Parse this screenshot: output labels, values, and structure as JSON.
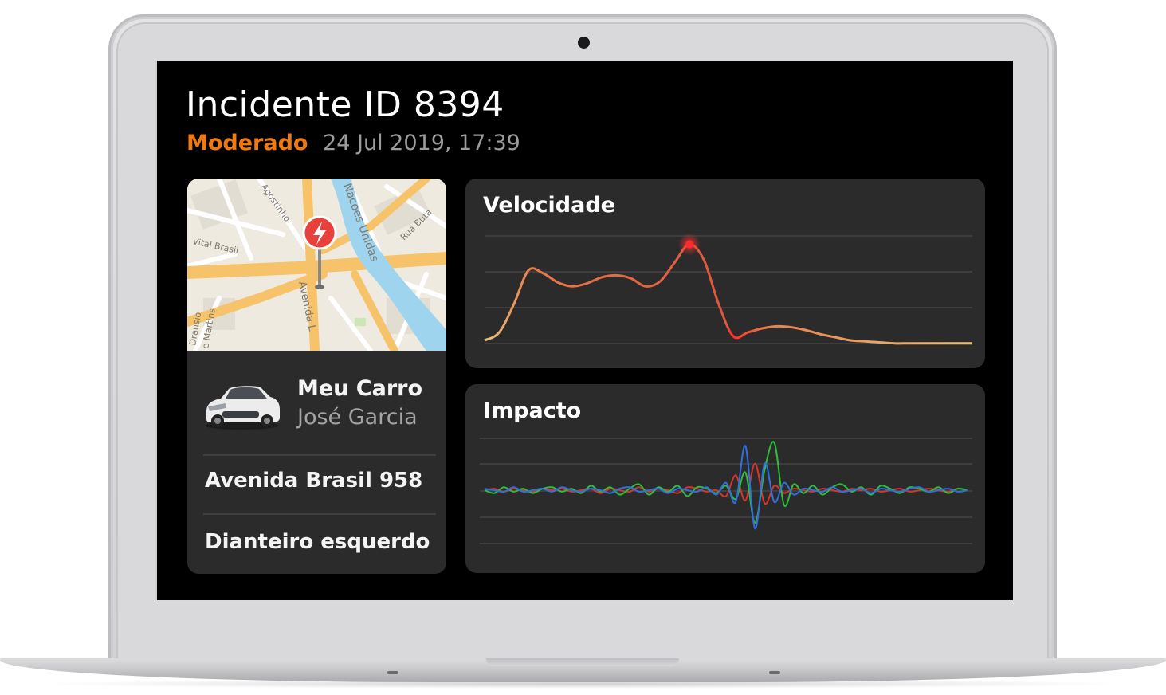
{
  "incident": {
    "title": "Incidente ID 8394",
    "severity": "Moderado",
    "datetime": "24 Jul 2019, 17:39"
  },
  "map": {
    "street_labels": [
      "Vital Brasil",
      "Agostinho",
      "Nacoes Unidas",
      "Rua Buta",
      "Avenida L",
      "Drausio",
      "e Martins"
    ],
    "pin_icon": "lightning-icon"
  },
  "vehicle": {
    "name": "Meu Carro",
    "owner": "José Garcia",
    "image_icon": "car-icon"
  },
  "details": {
    "address": "Avenida Brasil 958",
    "impact_position": "Dianteiro esquerdo"
  },
  "colors": {
    "severity": "#f07a12",
    "card_bg": "#2b2b2b",
    "screen_bg": "#000000",
    "speed_line_start": "#e8c47a",
    "speed_line_peak": "#ff2a2a",
    "impact_red": "#d9342b",
    "impact_green": "#2ebd3b",
    "impact_blue": "#2f6fe0"
  },
  "chart_data": [
    {
      "type": "line",
      "title": "Velocidade",
      "x": [
        0,
        3,
        6,
        9,
        12,
        15,
        18,
        21,
        24,
        27,
        30,
        33,
        36,
        39,
        42,
        45,
        48,
        51,
        54,
        57,
        60,
        63,
        66,
        69,
        72,
        75,
        78,
        81,
        84,
        87,
        90,
        93,
        96,
        100
      ],
      "series": [
        {
          "values": [
            4,
            12,
            40,
            74,
            71,
            62,
            58,
            61,
            67,
            69,
            66,
            58,
            63,
            82,
            100,
            84,
            40,
            8,
            12,
            16,
            18,
            17,
            14,
            10,
            7,
            4,
            3,
            2,
            1,
            1,
            1,
            1,
            1,
            1
          ]
        }
      ],
      "peak_index": 14,
      "ylim": [
        0,
        110
      ],
      "grid": true
    },
    {
      "type": "line",
      "title": "Impacto",
      "x": [
        0,
        2,
        4,
        6,
        8,
        10,
        12,
        14,
        16,
        18,
        20,
        22,
        24,
        26,
        28,
        30,
        32,
        34,
        36,
        38,
        40,
        42,
        44,
        46,
        48,
        50,
        52,
        54,
        56,
        58,
        60,
        62,
        64,
        66,
        68,
        70,
        72,
        74,
        76,
        78,
        80,
        82,
        84,
        86,
        88,
        90,
        92,
        94,
        96,
        98,
        100
      ],
      "series": [
        {
          "name": "red",
          "values": [
            0,
            1,
            -1,
            1,
            0,
            -1,
            1,
            0,
            1,
            -1,
            0,
            1,
            -2,
            1,
            0,
            -1,
            2,
            -1,
            1,
            0,
            -2,
            2,
            1,
            -1,
            0,
            -4,
            10,
            -7,
            18,
            -9,
            3,
            -2,
            1,
            0,
            -1,
            1,
            0,
            -1,
            1,
            0,
            1,
            -1,
            0,
            1,
            -1,
            0,
            1,
            0,
            -1,
            1,
            0
          ]
        },
        {
          "name": "green",
          "values": [
            0,
            -2,
            2,
            -1,
            1,
            -2,
            1,
            2,
            -1,
            1,
            -2,
            3,
            -1,
            2,
            -3,
            1,
            4,
            -3,
            2,
            -1,
            3,
            -4,
            2,
            1,
            -2,
            3,
            -6,
            12,
            -22,
            14,
            32,
            -10,
            4,
            -2,
            3,
            -3,
            2,
            4,
            -1,
            2,
            -3,
            3,
            1,
            -2,
            2,
            1,
            -1,
            2,
            -2,
            1,
            0
          ]
        },
        {
          "name": "blue",
          "values": [
            1,
            0,
            -1,
            2,
            -1,
            0,
            1,
            -1,
            2,
            0,
            -1,
            1,
            0,
            -2,
            1,
            2,
            -1,
            0,
            1,
            -2,
            1,
            0,
            -1,
            2,
            -3,
            5,
            -8,
            30,
            -26,
            18,
            -8,
            5,
            -3,
            1,
            0,
            -1,
            2,
            -1,
            0,
            1,
            -2,
            1,
            0,
            -1,
            1,
            2,
            -1,
            0,
            1,
            -1,
            0
          ]
        }
      ],
      "ylim": [
        -35,
        35
      ],
      "grid": true
    }
  ]
}
